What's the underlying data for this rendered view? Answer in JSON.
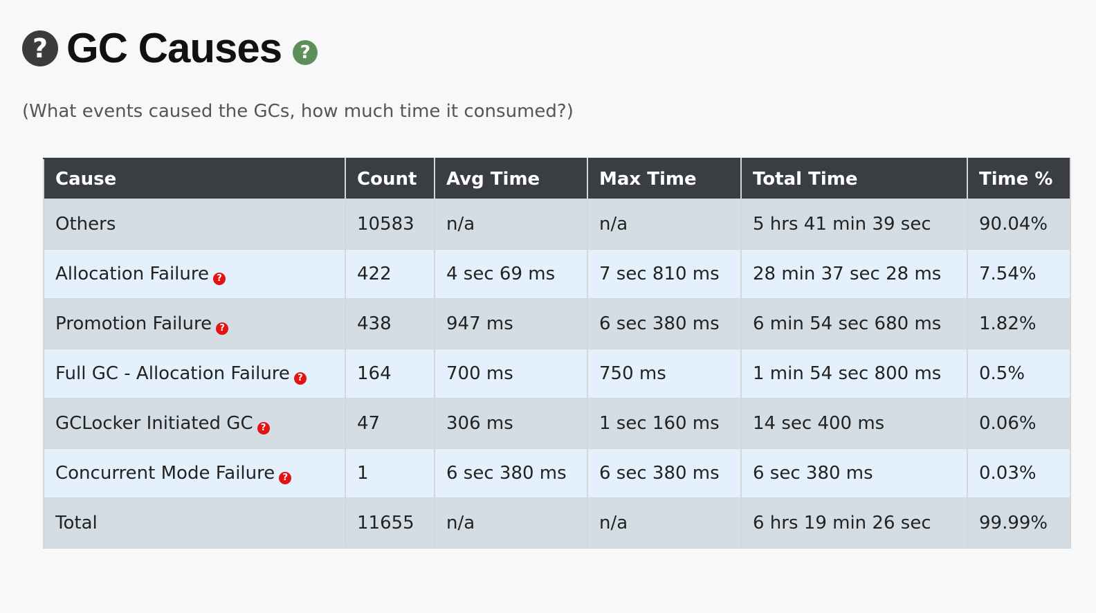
{
  "header": {
    "help_icon_glyph": "?",
    "title": "GC Causes",
    "title_help_glyph": "?",
    "subtitle": "(What events caused the GCs, how much time it consumed?)"
  },
  "colors": {
    "header_bg": "#3a3d41",
    "row_odd": "#d4dde3",
    "row_even": "#e4f0fb",
    "help_red": "#e41313",
    "help_green": "#5e8e5a"
  },
  "table": {
    "columns": [
      "Cause",
      "Count",
      "Avg Time",
      "Max Time",
      "Total Time",
      "Time %"
    ],
    "help_glyph": "?",
    "rows": [
      {
        "cause": "Others",
        "count": "10583",
        "avg": "n/a",
        "max": "n/a",
        "total": "5 hrs 41 min 39 sec",
        "pct": "90.04%"
      },
      {
        "cause": "Allocation Failure",
        "count": "422",
        "avg": "4 sec 69 ms",
        "max": "7 sec 810 ms",
        "total": "28 min 37 sec 28 ms",
        "pct": "7.54%"
      },
      {
        "cause": "Promotion Failure",
        "count": "438",
        "avg": "947 ms",
        "max": "6 sec 380 ms",
        "total": "6 min 54 sec 680 ms",
        "pct": "1.82%"
      },
      {
        "cause": "Full GC - Allocation Failure",
        "count": "164",
        "avg": "700 ms",
        "max": "750 ms",
        "total": "1 min 54 sec 800 ms",
        "pct": "0.5%"
      },
      {
        "cause": "GCLocker Initiated GC",
        "count": "47",
        "avg": "306 ms",
        "max": "1 sec 160 ms",
        "total": "14 sec 400 ms",
        "pct": "0.06%"
      },
      {
        "cause": "Concurrent Mode Failure",
        "count": "1",
        "avg": "6 sec 380 ms",
        "max": "6 sec 380 ms",
        "total": "6 sec 380 ms",
        "pct": "0.03%"
      },
      {
        "cause": "Total",
        "count": "11655",
        "avg": "n/a",
        "max": "n/a",
        "total": "6 hrs 19 min 26 sec",
        "pct": "99.99%"
      }
    ]
  }
}
